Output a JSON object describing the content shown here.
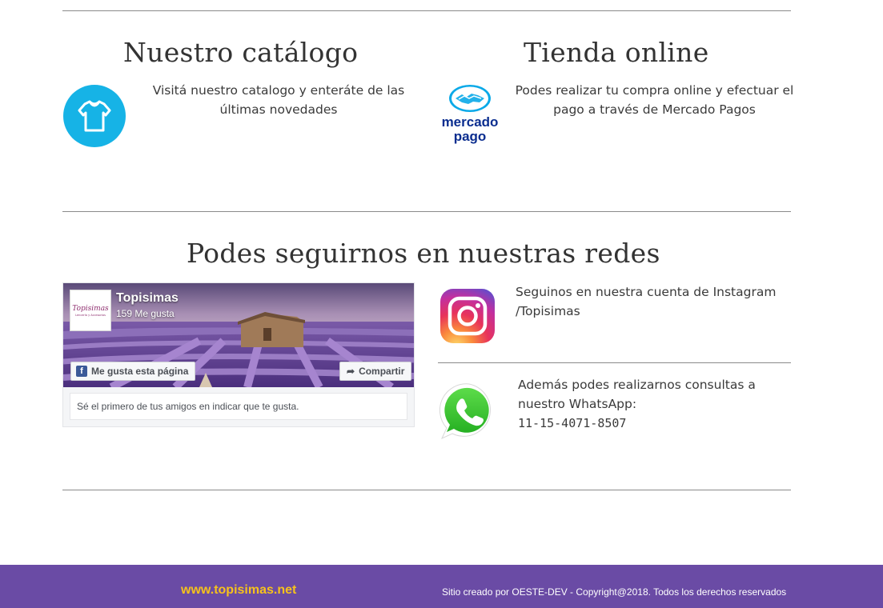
{
  "catalog": {
    "title": "Nuestro catálogo",
    "description_line1": "Visitá nuestro catalogo y enteráte de las",
    "description_line2": "últimas novedades",
    "icon": "tshirt-icon",
    "icon_color": "#16b3e6"
  },
  "store": {
    "title": "Tienda online",
    "description_line1": "Podes realizar tu compra online y efectuar el",
    "description_line2": "pago a través de Mercado Pagos",
    "logo_text_top": "mercado",
    "logo_text_bottom": "pago",
    "logo_color": "#0a2d8f"
  },
  "social": {
    "title": "Podes seguirnos en nuestras redes",
    "facebook": {
      "page_name": "Topisimas",
      "likes": "159 Me gusta",
      "thumb_text": "Topisimas",
      "thumb_sub": "Lencería y Accesorios",
      "like_button": "Me gusta esta página",
      "share_button": "Compartir",
      "friends_text": "Sé el primero de tus amigos en indicar que te gusta."
    },
    "instagram": {
      "line1": "Seguinos en nuestra cuenta de Instagram",
      "line2": "/Topisimas"
    },
    "whatsapp": {
      "line1": "Además podes realizarnos consultas a",
      "line2": "nuestro WhatsApp:",
      "phone": "11-15-4071-8507"
    }
  },
  "footer": {
    "site": "www.topisimas.net",
    "credit": "Sitio creado por OESTE-DEV - Copyright@2018. Todos los derechos reservados",
    "background": "#6a4ba5",
    "site_color": "#f6c21c"
  }
}
